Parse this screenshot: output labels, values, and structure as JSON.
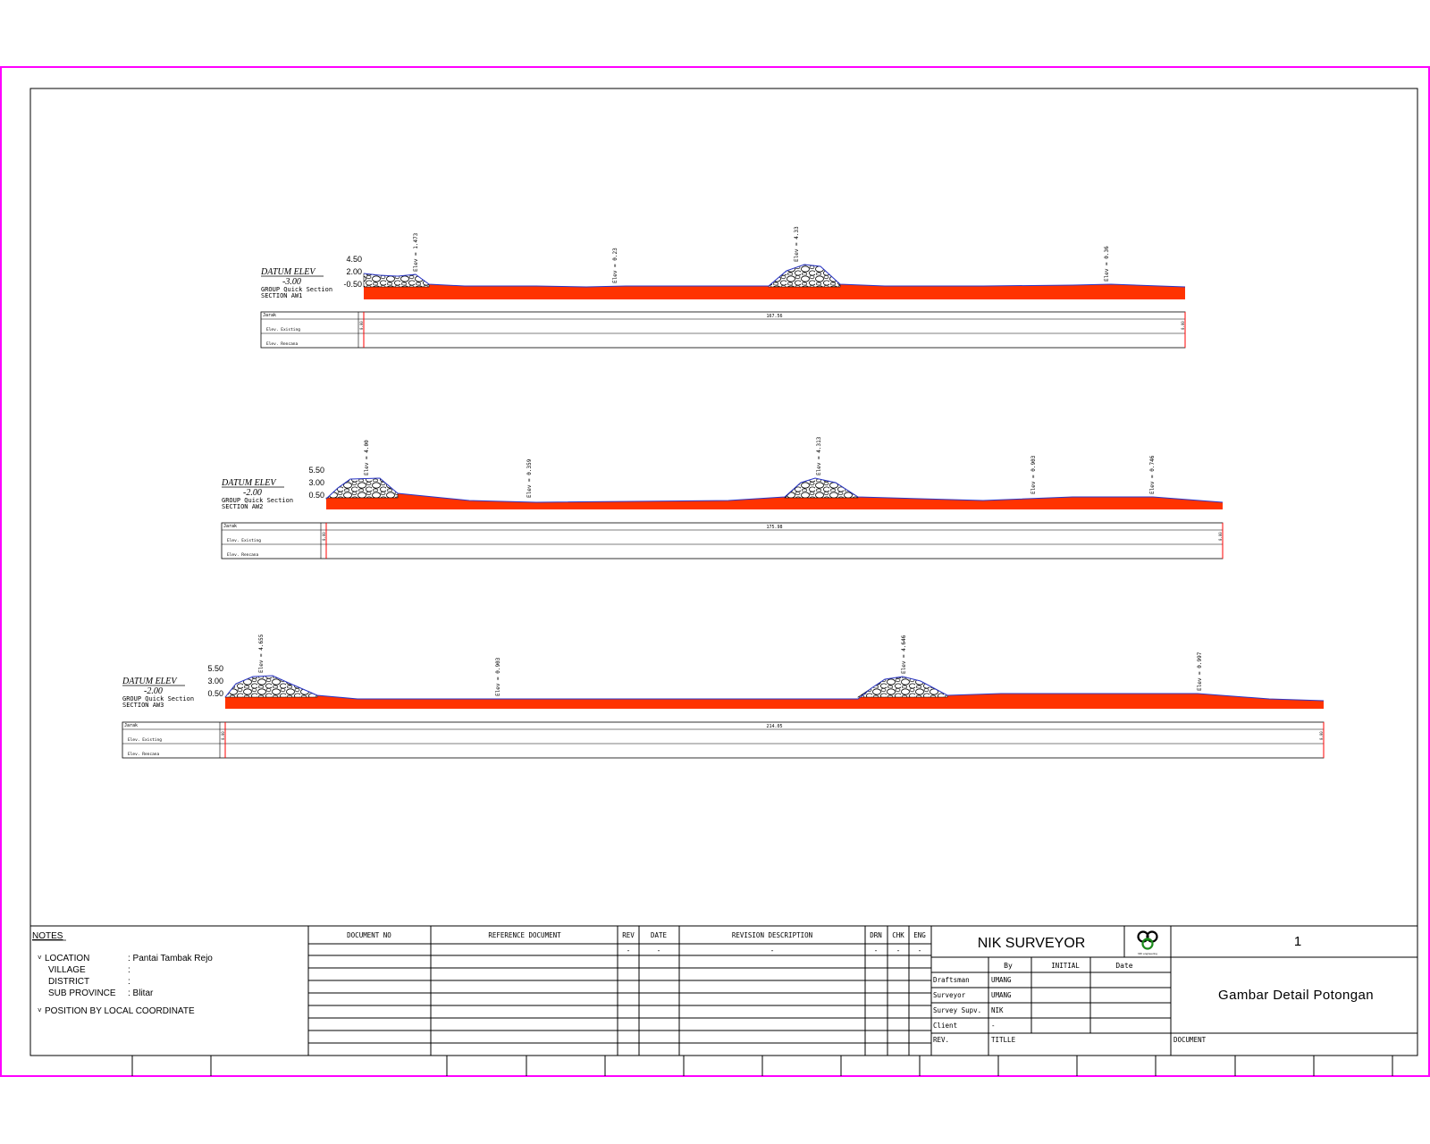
{
  "colors": {
    "sheet_border": "#ff00ff",
    "frame": "#000000",
    "fill": "#ff3300",
    "ground_line": "#2a36c8",
    "marker": "#ff0000"
  },
  "sections": [
    {
      "datum_label": "DATUM ELEV",
      "datum_value": "-3.00",
      "group_line": "GROUP   Quick Section",
      "section_line": "SECTION  AW1",
      "y_ticks": [
        "4.50",
        "2.00",
        "-0.50"
      ],
      "annotations": [
        "Elev = 1.473",
        "Elev = 0.23",
        "Elev = 4.33",
        "Elev = 0.36"
      ],
      "table_rows": [
        "Jarak",
        "Elev. Existing",
        "Elev. Rencana"
      ],
      "distance_total": "167.56",
      "start_label": "0.00",
      "end_label": "0.00"
    },
    {
      "datum_label": "DATUM ELEV",
      "datum_value": "-2.00",
      "group_line": "GROUP   Quick Section",
      "section_line": "SECTION  AW2",
      "y_ticks": [
        "5.50",
        "3.00",
        "0.50"
      ],
      "annotations": [
        "Elev = 4.00",
        "Elev = 0.359",
        "Elev = 4.313",
        "Elev = 0.903",
        "Elev = 0.746"
      ],
      "table_rows": [
        "Jarak",
        "Elev. Existing",
        "Elev. Rencana"
      ],
      "distance_total": "175.98",
      "start_label": "0.00",
      "end_label": "0.00"
    },
    {
      "datum_label": "DATUM ELEV",
      "datum_value": "-2.00",
      "group_line": "GROUP   Quick Section",
      "section_line": "SECTION  AW3",
      "y_ticks": [
        "5.50",
        "3.00",
        "0.50"
      ],
      "annotations": [
        "Elev = 4.655",
        "Elev = 0.903",
        "Elev = 4.646",
        "Elev = 0.997"
      ],
      "table_rows": [
        "Jarak",
        "Elev. Existing",
        "Elev. Rencana"
      ],
      "distance_total": "214.05",
      "start_label": "0.00",
      "end_label": "0.00"
    }
  ],
  "notes": {
    "heading": "NOTES",
    "items": [
      {
        "label": "LOCATION",
        "value": ": Pantai Tambak Rejo"
      },
      {
        "label": "VILLAGE",
        "value": ":"
      },
      {
        "label": "DISTRICT",
        "value": ":"
      },
      {
        "label": "SUB PROVINCE",
        "value": ": Blitar"
      }
    ],
    "position": "POSITION BY LOCAL COORDINATE"
  },
  "revision_table": {
    "headers": [
      "DOCUMENT NO",
      "REFERENCE DOCUMENT",
      "REV",
      "DATE",
      "REVISION DESCRIPTION",
      "DRN",
      "CHK",
      "ENG"
    ],
    "first_row": [
      "",
      "",
      "-",
      "-",
      "-",
      "-",
      "-",
      "-"
    ]
  },
  "title_block": {
    "company": "NIK SURVEYOR",
    "logo_text": "NIK engineering",
    "sheet_number": "1",
    "col_headers": [
      "By",
      "INITIAL",
      "Date"
    ],
    "rows": [
      {
        "role": "Draftsman",
        "by": "UMANG"
      },
      {
        "role": "Surveyor",
        "by": "UMANG"
      },
      {
        "role": "Survey Supv.",
        "by": "NIK"
      },
      {
        "role": "Client",
        "by": "-"
      }
    ],
    "drawing_title": "Gambar Detail Potongan",
    "rev_label": "REV.",
    "title_label": "TITLLE",
    "document_label": "DOCUMENT"
  }
}
